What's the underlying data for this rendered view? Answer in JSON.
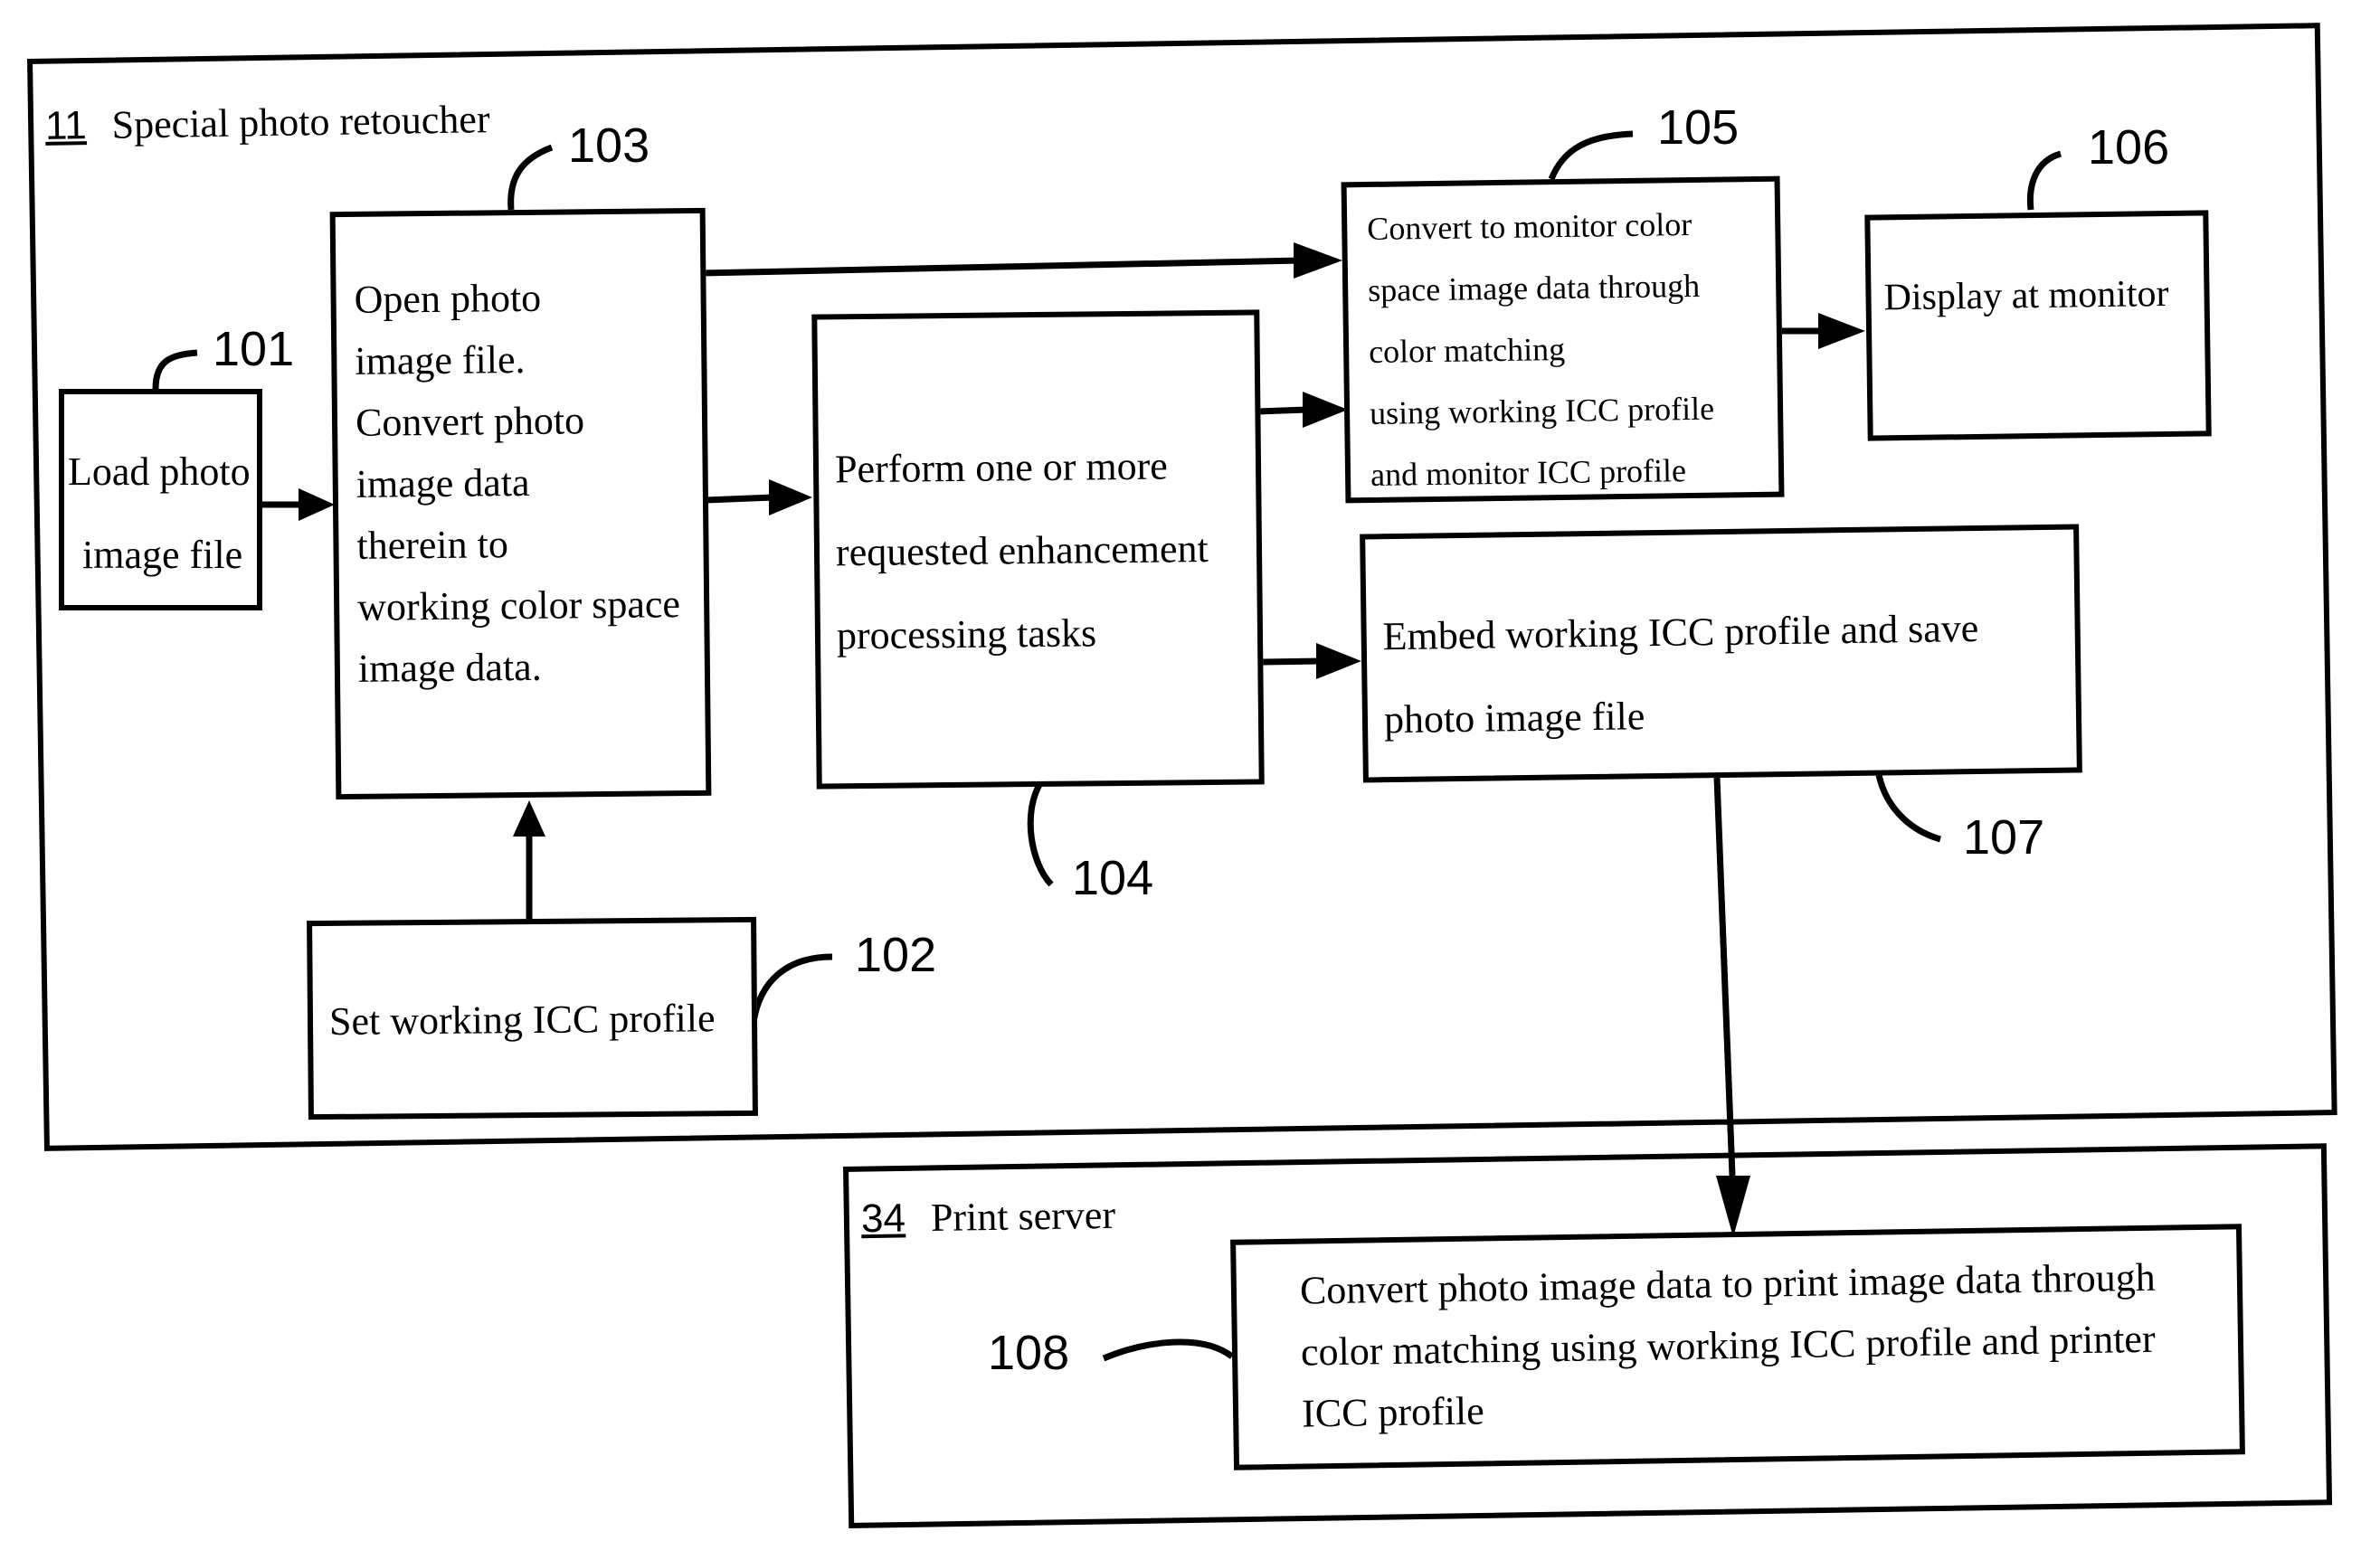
{
  "containers": {
    "retoucher": {
      "id": "11",
      "label": "Special photo retoucher"
    },
    "print_server": {
      "id": "34",
      "label": "Print server"
    }
  },
  "blocks": [
    {
      "ref": "101",
      "lines": [
        "Load photo",
        "image file"
      ]
    },
    {
      "ref": "102",
      "lines": [
        "Set working ICC profile"
      ]
    },
    {
      "ref": "103",
      "lines": [
        "Open photo",
        "image file.",
        "Convert photo",
        "image data",
        "therein to",
        "working color space",
        "image data."
      ]
    },
    {
      "ref": "104",
      "lines": [
        "Perform one or more",
        "requested enhancement",
        "processing tasks"
      ]
    },
    {
      "ref": "105",
      "lines": [
        "Convert to monitor color",
        "space image data through",
        "color matching",
        "using working ICC profile",
        "and monitor ICC profile"
      ]
    },
    {
      "ref": "106",
      "lines": [
        "Display at monitor"
      ]
    },
    {
      "ref": "107",
      "lines": [
        "Embed working ICC profile and save",
        "photo image file"
      ]
    },
    {
      "ref": "108",
      "lines": [
        "Convert photo image data to print image data through",
        "color matching using working ICC profile and printer",
        "ICC profile"
      ]
    }
  ]
}
